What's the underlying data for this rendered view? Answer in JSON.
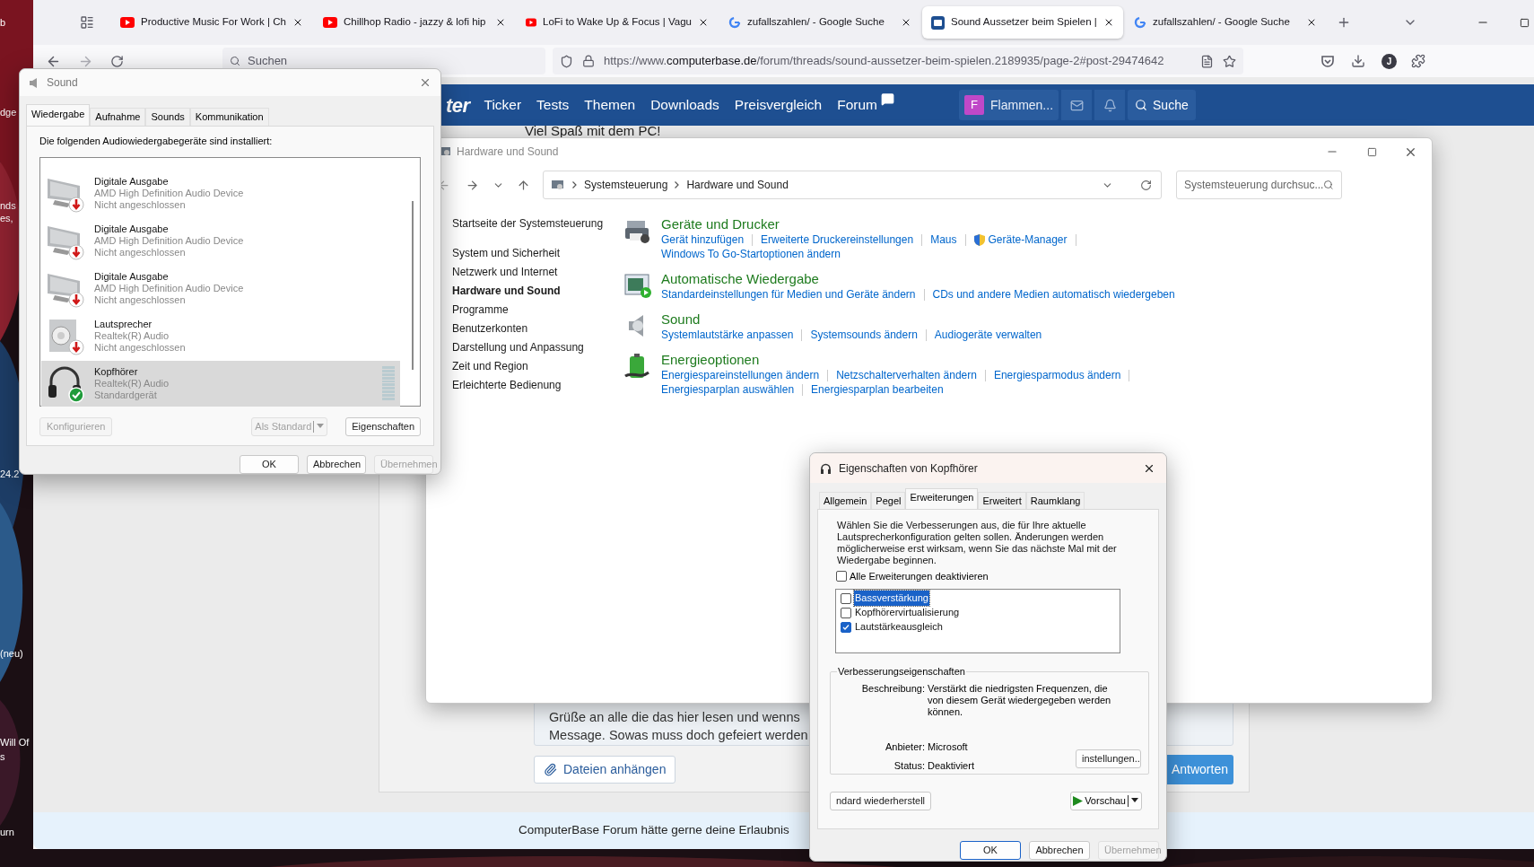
{
  "desktop": {
    "labels": [
      "b",
      "dge",
      "nds",
      "es,",
      "24.2",
      "(neu)",
      "Will Of",
      "s",
      "urn"
    ]
  },
  "browser": {
    "tabs": [
      {
        "title": "Productive Music For Work | Ch",
        "kind": "youtube",
        "selected": false
      },
      {
        "title": "Chillhop Radio - jazzy & lofi hip",
        "kind": "youtube",
        "selected": false
      },
      {
        "title": "LoFi to Wake Up & Focus | Vagu",
        "kind": "youtube",
        "selected": false
      },
      {
        "title": "zufallszahlen/ - Google Suche",
        "kind": "google",
        "selected": false
      },
      {
        "title": "Sound Aussetzer beim Spielen |",
        "kind": "site",
        "selected": true
      },
      {
        "title": "zufallszahlen/ - Google Suche",
        "kind": "google",
        "selected": false
      }
    ],
    "search": {
      "placeholder": "Suchen"
    },
    "url": {
      "scheme": "https://www.",
      "domain": "computerbase.de",
      "path": "/forum/threads/sound-aussetzer-beim-spielen.2189935/page-2#post-29474642"
    },
    "account_initial": "J"
  },
  "site": {
    "logo_fragment": "ter",
    "nav": [
      "Ticker",
      "Tests",
      "Themen",
      "Downloads",
      "Preisvergleich",
      "Forum"
    ],
    "user": {
      "initial": "F",
      "name": "Flammen..."
    },
    "search": "Suche",
    "greeting": "Viel Spaß mit dem PC!",
    "post_lines": [
      "Grüße an alle die das hier lesen und wenns",
      "Message. Sowas muss doch gefeiert werden"
    ],
    "attach": "Dateien anhängen",
    "reply": "Antworten",
    "consent": "ComputerBase Forum hätte gerne deine Erlaubnis"
  },
  "control_panel": {
    "title": "Hardware und Sound",
    "breadcrumb": [
      "Systemsteuerung",
      "Hardware und Sound"
    ],
    "search": {
      "placeholder": "Systemsteuerung durchsuc..."
    },
    "home_link": "Startseite der Systemsteuerung",
    "sidebar": [
      {
        "label": "System und Sicherheit",
        "selected": false
      },
      {
        "label": "Netzwerk und Internet",
        "selected": false
      },
      {
        "label": "Hardware und Sound",
        "selected": true
      },
      {
        "label": "Programme",
        "selected": false
      },
      {
        "label": "Benutzerkonten",
        "selected": false
      },
      {
        "label": "Darstellung und Anpassung",
        "selected": false
      },
      {
        "label": "Zeit und Region",
        "selected": false
      },
      {
        "label": "Erleichterte Bedienung",
        "selected": false
      }
    ],
    "categories": [
      {
        "title": "Geräte und Drucker",
        "kind": "printer",
        "lines": [
          [
            {
              "text": "Gerät hinzufügen",
              "admin": false
            },
            {
              "text": "Erweiterte Druckereinstellungen",
              "admin": false
            },
            {
              "text": "Maus",
              "admin": false
            },
            {
              "text": "Geräte-Manager",
              "admin": true
            }
          ],
          [
            {
              "text": "Windows To Go-Startoptionen ändern",
              "admin": false
            }
          ]
        ]
      },
      {
        "title": "Automatische Wiedergabe",
        "kind": "autoplay",
        "lines": [
          [
            {
              "text": "Standardeinstellungen für Medien und Geräte ändern",
              "admin": false
            },
            {
              "text": "CDs und andere Medien automatisch wiedergeben",
              "admin": false
            }
          ]
        ]
      },
      {
        "title": "Sound",
        "kind": "speaker",
        "lines": [
          [
            {
              "text": "Systemlautstärke anpassen",
              "admin": false
            },
            {
              "text": "Systemsounds ändern",
              "admin": false
            },
            {
              "text": "Audiogeräte verwalten",
              "admin": false
            }
          ]
        ]
      },
      {
        "title": "Energieoptionen",
        "kind": "battery",
        "lines": [
          [
            {
              "text": "Energiespareinstellungen ändern",
              "admin": false
            },
            {
              "text": "Netzschalterverhalten ändern",
              "admin": false
            },
            {
              "text": "Energiesparmodus ändern",
              "admin": false
            }
          ],
          [
            {
              "text": "Energiesparplan auswählen",
              "admin": false
            },
            {
              "text": "Energiesparplan bearbeiten",
              "admin": false
            }
          ]
        ]
      }
    ]
  },
  "sound_dialog": {
    "title": "Sound",
    "tabs": [
      {
        "label": "Wiedergabe",
        "selected": true
      },
      {
        "label": "Aufnahme",
        "selected": false
      },
      {
        "label": "Sounds",
        "selected": false
      },
      {
        "label": "Kommunikation",
        "selected": false
      }
    ],
    "heading": "Die folgenden Audiowiedergabegeräte sind installiert:",
    "devices": [
      {
        "name": "Digitale Ausgabe",
        "driver": "AMD High Definition Audio Device",
        "status": "Nicht angeschlossen",
        "kind": "monitor",
        "default": false,
        "selected": false
      },
      {
        "name": "Digitale Ausgabe",
        "driver": "AMD High Definition Audio Device",
        "status": "Nicht angeschlossen",
        "kind": "monitor",
        "default": false,
        "selected": false
      },
      {
        "name": "Digitale Ausgabe",
        "driver": "AMD High Definition Audio Device",
        "status": "Nicht angeschlossen",
        "kind": "monitor",
        "default": false,
        "selected": false
      },
      {
        "name": "Lautsprecher",
        "driver": "Realtek(R) Audio",
        "status": "Nicht angeschlossen",
        "kind": "speaker",
        "default": false,
        "selected": false
      },
      {
        "name": "Kopfhörer",
        "driver": "Realtek(R) Audio",
        "status": "Standardgerät",
        "kind": "headphones",
        "default": true,
        "selected": true,
        "level": 0
      }
    ],
    "buttons": [
      {
        "label": "Konfigurieren",
        "disabled": true
      },
      {
        "label": "Als Standard",
        "disabled": true
      },
      {
        "label": "Eigenschaften",
        "disabled": false
      }
    ],
    "footer": [
      {
        "label": "OK",
        "disabled": false
      },
      {
        "label": "Abbrechen",
        "disabled": false
      },
      {
        "label": "Übernehmen",
        "disabled": true
      }
    ]
  },
  "properties_dialog": {
    "title": "Eigenschaften von Kopfhörer",
    "tabs": [
      {
        "label": "Allgemein",
        "selected": false
      },
      {
        "label": "Pegel",
        "selected": false
      },
      {
        "label": "Erweiterungen",
        "selected": true
      },
      {
        "label": "Erweitert",
        "selected": false
      },
      {
        "label": "Raumklang",
        "selected": false
      }
    ],
    "intro": "Wählen Sie die Verbesserungen aus, die für Ihre aktuelle Lautsprecherkonfiguration gelten sollen. Änderungen werden möglicherweise erst wirksam, wenn Sie das nächste Mal mit der Wiedergabe beginnen.",
    "disable_all": {
      "label": "Alle Erweiterungen deaktivieren",
      "checked": false
    },
    "enhancements": [
      {
        "label": "Bassverstärkung",
        "checked": false,
        "selected": true
      },
      {
        "label": "Kopfhörervirtualisierung",
        "checked": false,
        "selected": false
      },
      {
        "label": "Lautstärkeausgleich",
        "checked": true,
        "selected": false
      }
    ],
    "group": "Verbesserungseigenschaften",
    "fields": [
      {
        "label": "Beschreibung:",
        "value": "Verstärkt die niedrigsten Frequenzen, die von diesem Gerät wiedergegeben werden können."
      },
      {
        "label": "Anbieter:",
        "value": "Microsoft"
      },
      {
        "label": "Status:",
        "value": "Deaktiviert"
      }
    ],
    "settings_button": "instellungen..",
    "restore_button": "ndard wiederherstell",
    "preview_button": "Vorschau",
    "footer": [
      {
        "label": "OK",
        "disabled": false,
        "default": true
      },
      {
        "label": "Abbrechen",
        "disabled": false,
        "default": false
      },
      {
        "label": "Übernehmen",
        "disabled": true,
        "default": false
      }
    ]
  }
}
